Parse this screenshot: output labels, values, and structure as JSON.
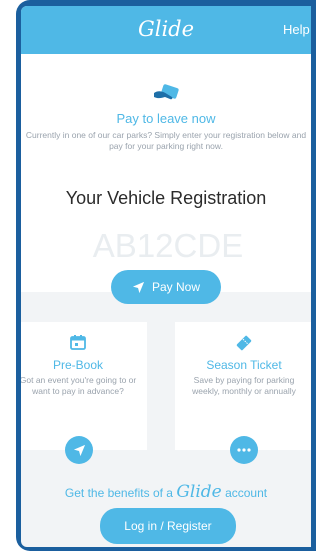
{
  "header": {
    "logo": "Glide",
    "help": "Help"
  },
  "pay_section": {
    "icon": "hand-card-icon",
    "title": "Pay to leave now",
    "description": "Currently in one of our car parks? Simply enter your registration below and pay for your parking right now.",
    "registration_label": "Your Vehicle Registration",
    "registration_placeholder": "AB12CDE",
    "pay_button": "Pay Now"
  },
  "options": [
    {
      "icon": "calendar-icon",
      "title": "Pre-Book",
      "description": "Got an event you're going to or want to pay in advance?",
      "action_icon": "send-icon"
    },
    {
      "icon": "ticket-icon",
      "title": "Season Ticket",
      "description": "Save by paying for parking weekly, monthly or annually",
      "action_icon": "more-icon"
    }
  ],
  "footer": {
    "benefits_prefix": "Get the benefits of a",
    "benefits_brand": "Glide",
    "benefits_suffix": "account",
    "login_button": "Log in / Register"
  },
  "colors": {
    "accent": "#4fb8e6",
    "frame": "#1b5f9e",
    "background": "#f2f4f6"
  }
}
